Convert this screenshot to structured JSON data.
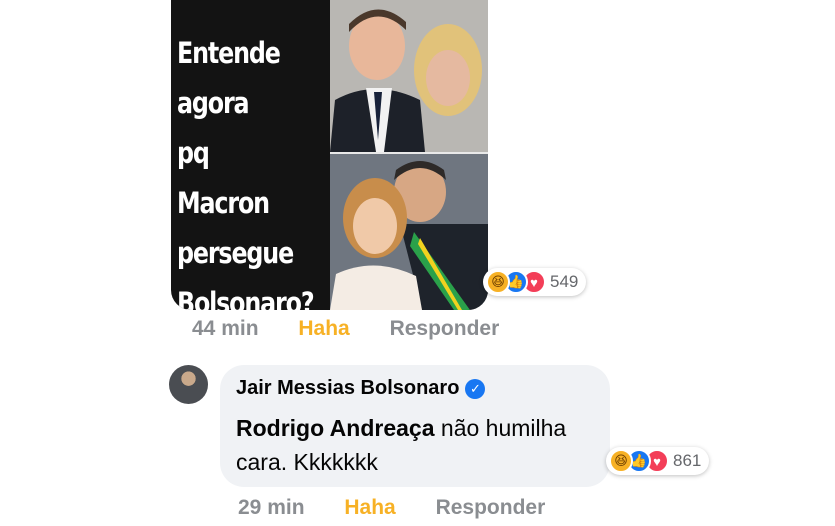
{
  "post": {
    "meme_text": "Entende\nagora\npq Macron\npersegue\nBolsonaro?",
    "reactions": {
      "icons": [
        "haha-icon",
        "like-icon",
        "love-icon"
      ],
      "count": "549"
    },
    "meta": {
      "time": "44 min",
      "haha": "Haha",
      "reply": "Responder"
    }
  },
  "reply": {
    "author": "Jair Messias Bolsonaro",
    "mention": "Rodrigo Andreaça",
    "text": " não humilha cara. Kkkkkkk",
    "reactions": {
      "icons": [
        "haha-icon",
        "like-icon",
        "love-icon"
      ],
      "count": "861"
    },
    "meta": {
      "time": "29 min",
      "haha": "Haha",
      "reply": "Responder"
    }
  },
  "colors": {
    "haha": "#f7b125",
    "like": "#1877f2",
    "love": "#f33e58",
    "meta": "#8a8d91",
    "bubble": "#f0f2f5"
  }
}
